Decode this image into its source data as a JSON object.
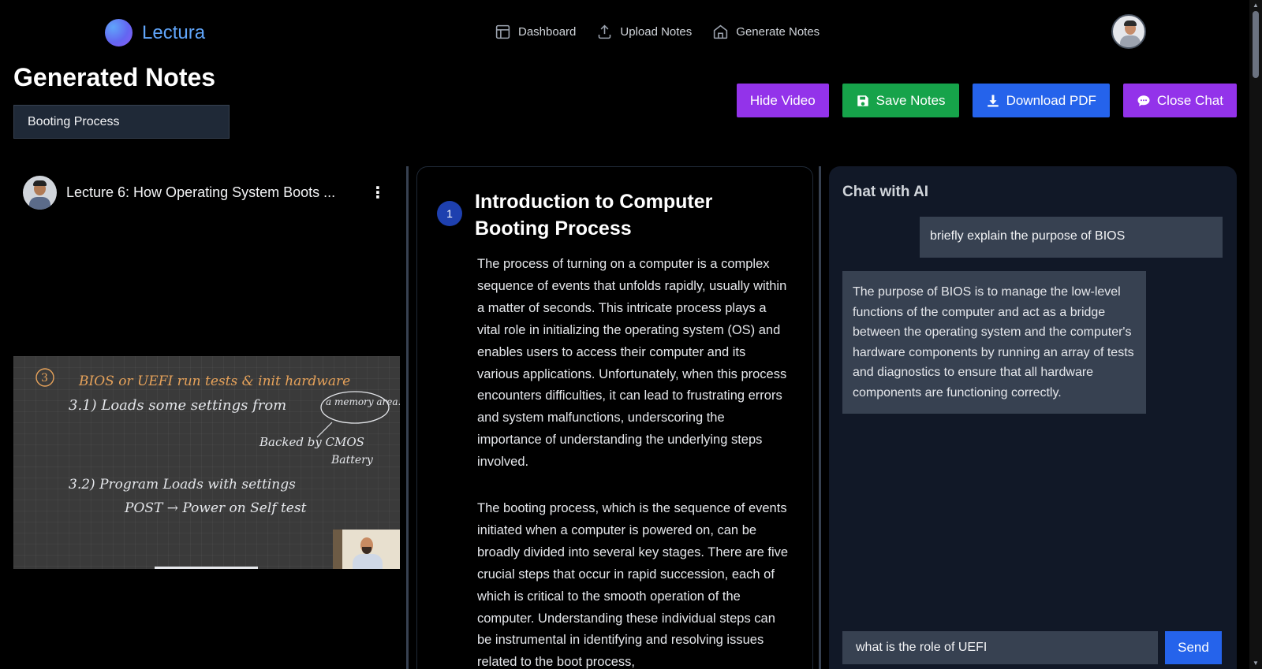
{
  "app": {
    "name": "Lectura"
  },
  "nav": {
    "items": [
      {
        "label": "Dashboard",
        "icon": "layout-icon"
      },
      {
        "label": "Upload Notes",
        "icon": "upload-icon"
      },
      {
        "label": "Generate Notes",
        "icon": "home-icon"
      }
    ]
  },
  "page": {
    "title": "Generated Notes",
    "notes_title_value": "Booting Process"
  },
  "actions": {
    "hide_video": "Hide Video",
    "save_notes": "Save Notes",
    "download_pdf": "Download PDF",
    "close_chat": "Close Chat"
  },
  "video": {
    "title": "Lecture 6: How Operating System Boots ...",
    "board_lines": [
      "BIOS or UEFI run tests & init hardware",
      "3.1) Loads some settings from",
      "a memory area.",
      "Backed by CMOS",
      "Battery",
      "3.2) Program Loads with settings",
      "POST → Power on Self test"
    ],
    "board_step": "3"
  },
  "notes": {
    "section_number": "1",
    "section_title": "Introduction to Computer Booting Process",
    "paragraphs": [
      "The process of turning on a computer is a complex sequence of events that unfolds rapidly, usually within a matter of seconds. This intricate process plays a vital role in initializing the operating system (OS) and enables users to access their computer and its various applications. Unfortunately, when this process encounters difficulties, it can lead to frustrating errors and system malfunctions, underscoring the importance of understanding the underlying steps involved.",
      "The booting process, which is the sequence of events initiated when a computer is powered on, can be broadly divided into several key stages. There are five crucial steps that occur in rapid succession, each of which is critical to the smooth operation of the computer. Understanding these individual steps can be instrumental in identifying and resolving issues related to the boot process,"
    ]
  },
  "chat": {
    "title": "Chat with AI",
    "messages": [
      {
        "role": "user",
        "text": "briefly explain the purpose of BIOS"
      },
      {
        "role": "ai",
        "text": "The purpose of BIOS is to manage the low-level functions of the computer and act as a bridge between the operating system and the computer's hardware components by running an array of tests and diagnostics to ensure that all hardware components are functioning correctly."
      }
    ],
    "input_value": "what is the role of UEFI",
    "send_label": "Send"
  },
  "colors": {
    "accent_blue": "#2563eb",
    "purple": "#9333ea",
    "green": "#16a34a",
    "panel": "#111827",
    "bubble": "#374151"
  }
}
